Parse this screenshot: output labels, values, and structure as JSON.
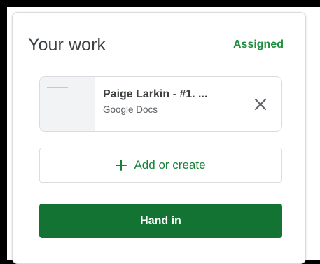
{
  "work_panel": {
    "title": "Your work",
    "status": "Assigned",
    "attachment": {
      "name": "Paige Larkin - #1. ...",
      "type": "Google Docs",
      "thumbnail_icon": "document-thumbnail",
      "remove_icon": "close-icon"
    },
    "add_button": {
      "icon": "plus-icon",
      "label": "Add or create"
    },
    "hand_in_button": {
      "label": "Hand in"
    }
  },
  "colors": {
    "status_green": "#1e8e3e",
    "accent_green": "#188038",
    "button_green": "#137333",
    "border": "#dadce0",
    "text_primary": "#3c4043",
    "text_secondary": "#5f6368"
  }
}
